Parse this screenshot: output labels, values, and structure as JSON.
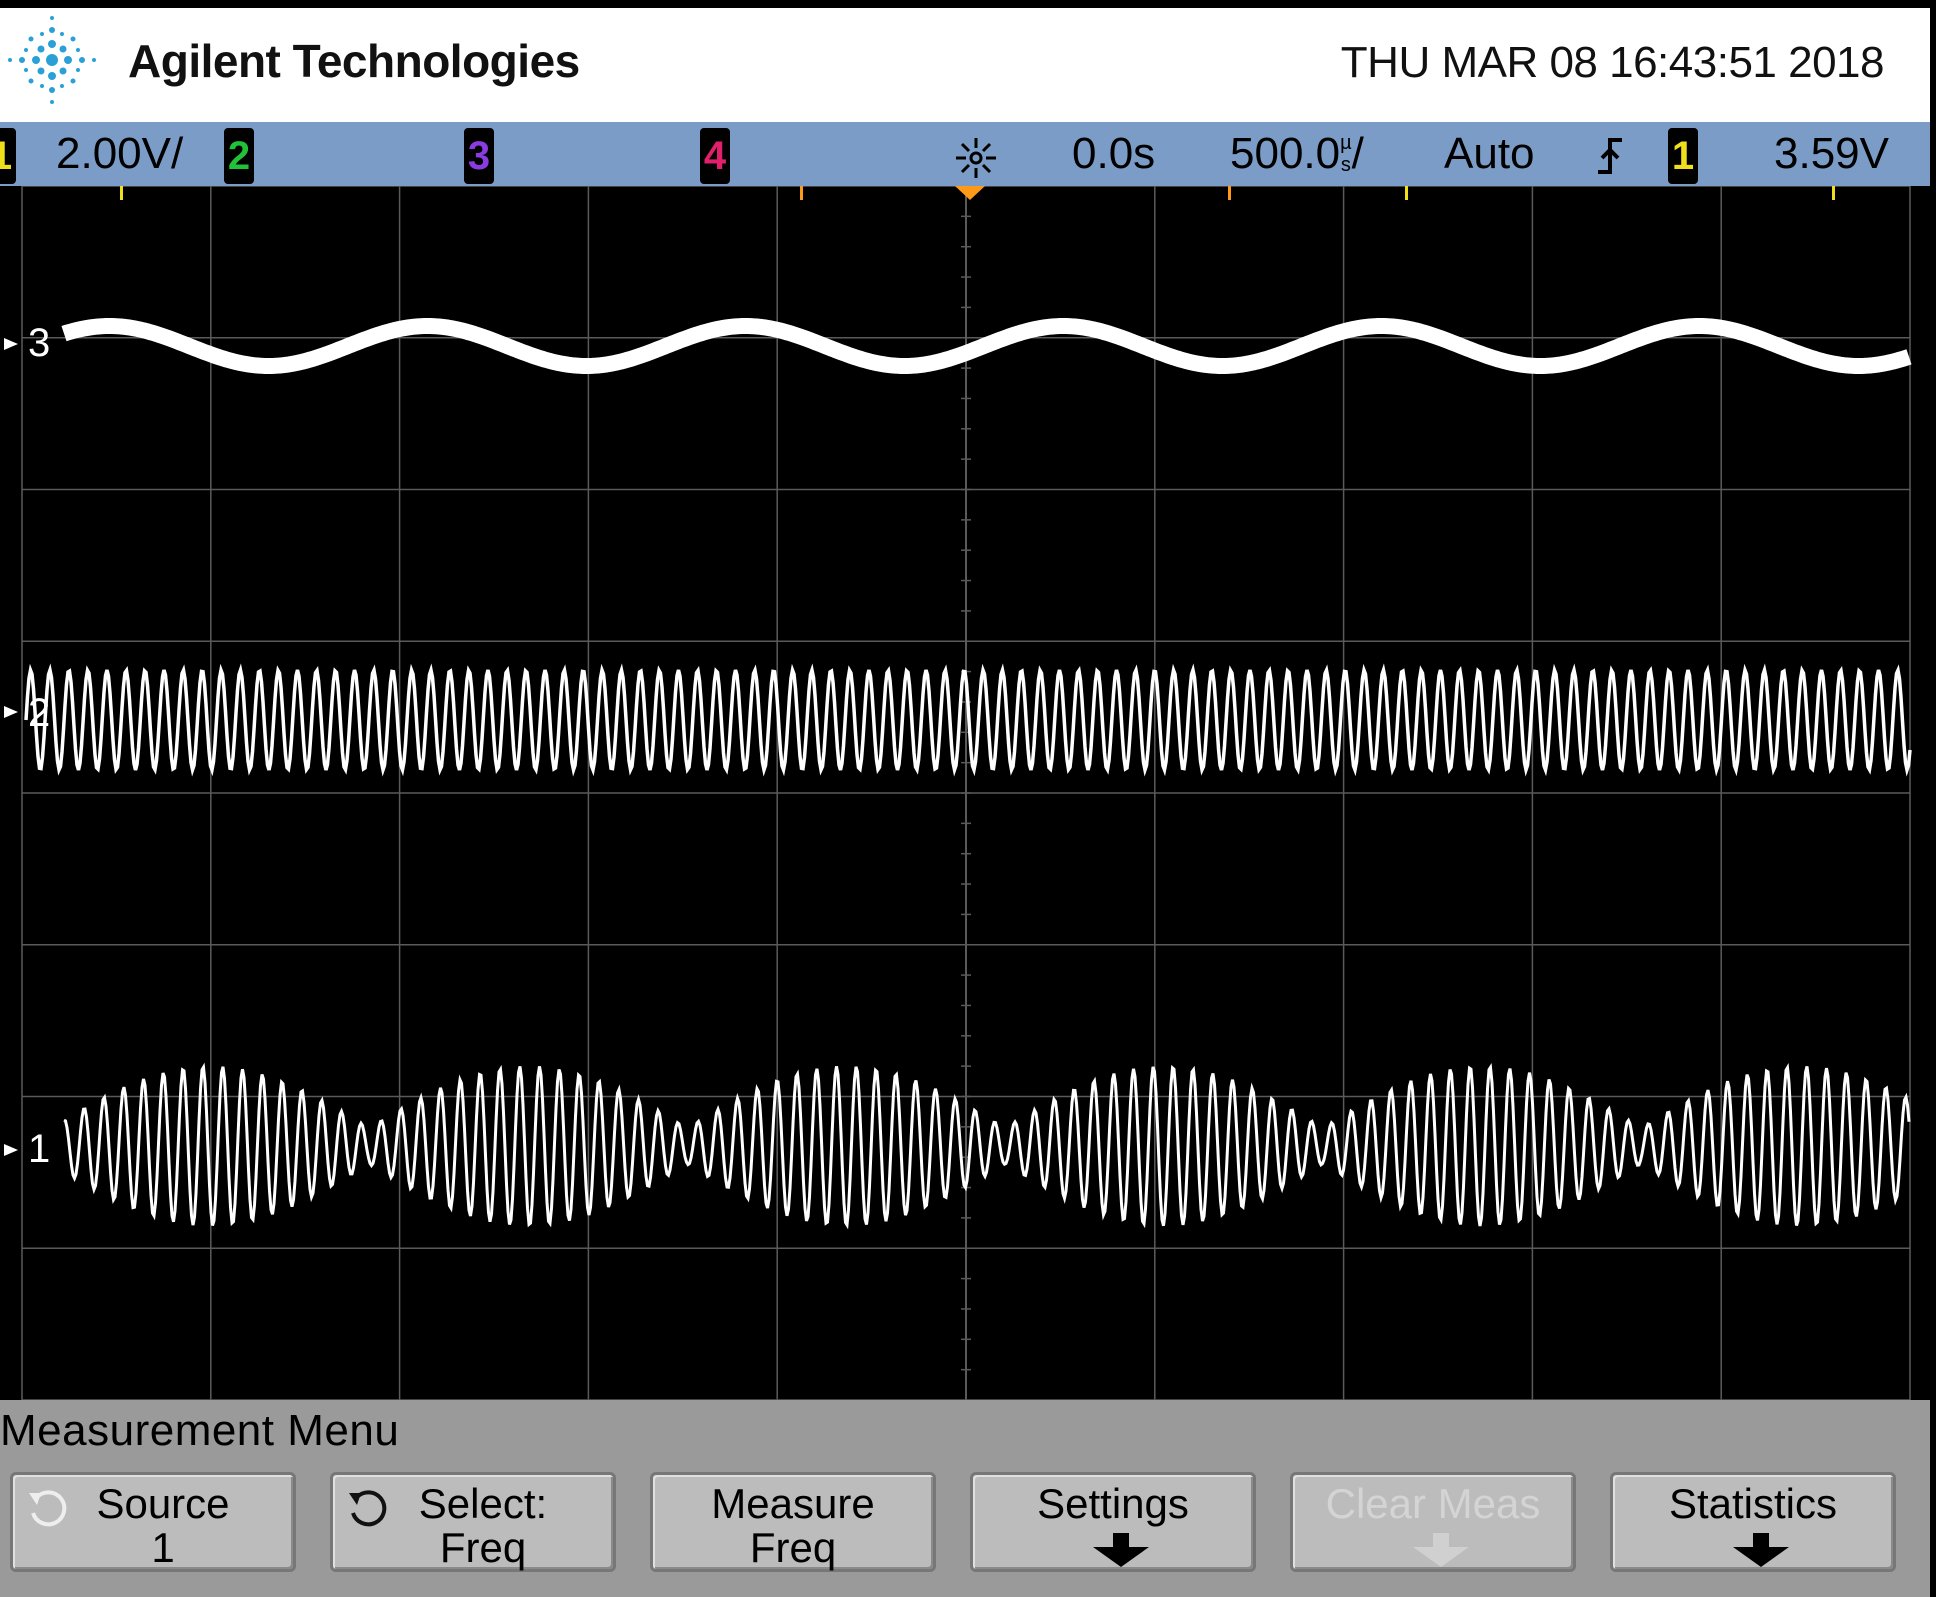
{
  "header": {
    "brand": "Agilent Technologies",
    "datetime": "THU MAR 08 16:43:51 2018"
  },
  "status": {
    "ch1_label": "1",
    "ch1_scale": "2.00V/",
    "ch2_label": "2",
    "ch3_label": "3",
    "ch4_label": "4",
    "time_offset": "0.0s",
    "time_scale": "500.0",
    "time_unit_top": "µ",
    "time_unit_bottom": "s",
    "time_scale_suffix": "/",
    "trigger_mode": "Auto",
    "trigger_source": "1",
    "trigger_level": "3.59V"
  },
  "traces": {
    "ch3_marker": "3",
    "ch2_marker": "2",
    "ch1_marker": "1"
  },
  "colors": {
    "ch1": "#f0e01c",
    "ch2": "#22c238",
    "ch3": "#8a3ce0",
    "ch4": "#e0206c",
    "trace": "#ffffff",
    "grid": "#5a5a5a",
    "status_bar": "#7b9cc6"
  },
  "menu": {
    "title": "Measurement Menu",
    "keys": [
      {
        "line1": "Source",
        "line2": "1",
        "icon": "rotate-knob-icon"
      },
      {
        "line1": "Select:",
        "line2": "Freq",
        "icon": "rotate-knob-icon"
      },
      {
        "line1": "Measure",
        "line2": "Freq"
      },
      {
        "line1": "Settings",
        "line2": "",
        "icon": "down-arrow-icon"
      },
      {
        "line1": "Clear Meas",
        "line2": "",
        "icon": "down-arrow-icon"
      },
      {
        "line1": "Statistics",
        "line2": "",
        "icon": "down-arrow-icon"
      }
    ]
  }
}
